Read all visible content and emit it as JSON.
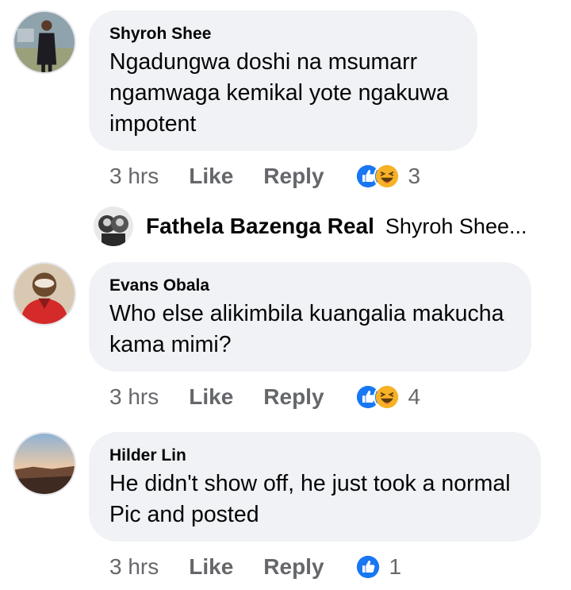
{
  "comments": [
    {
      "author": "Shyroh Shee",
      "text": [
        "Ngadungwa doshi na msumarr",
        "ngamwaga kemikal yote ngakuwa",
        "impotent"
      ],
      "time": "3 hrs",
      "like_label": "Like",
      "reply_label": "Reply",
      "reaction_count": "3",
      "reactions": [
        "like-icon",
        "haha-icon"
      ]
    },
    {
      "author": "Evans Obala",
      "text": [
        "Who else alikimbila kuangalia makucha",
        "kama mimi?"
      ],
      "time": "3 hrs",
      "like_label": "Like",
      "reply_label": "Reply",
      "reaction_count": "4",
      "reactions": [
        "like-icon",
        "haha-icon"
      ]
    },
    {
      "author": "Hilder Lin",
      "text": [
        "He didn't show off, he just took a normal",
        "Pic and posted"
      ],
      "time": "3 hrs",
      "like_label": "Like",
      "reply_label": "Reply",
      "reaction_count": "1",
      "reactions": [
        "like-icon"
      ]
    }
  ],
  "reply_preview": {
    "author": "Fathela Bazenga Real",
    "text": "Shyroh Shee",
    "ellipsis": "..."
  },
  "colors": {
    "bubble": "#f0f2f5",
    "muted": "#65676b",
    "like_blue": "#1877f2",
    "haha_yellow": "#f7b125"
  }
}
